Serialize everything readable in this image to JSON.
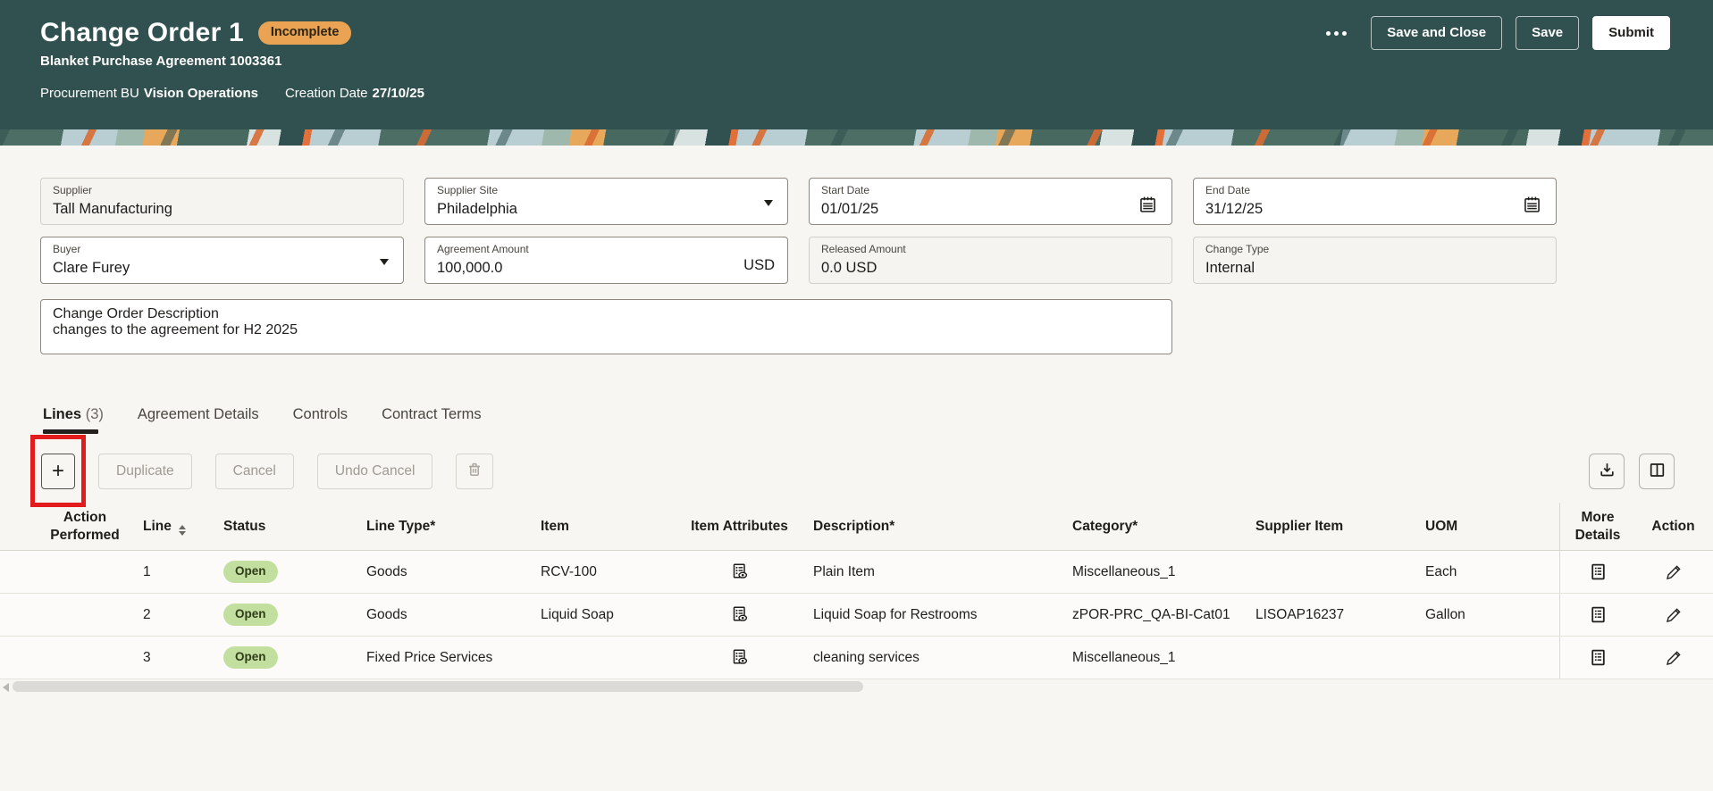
{
  "header": {
    "title": "Change Order 1",
    "status_badge": "Incomplete",
    "subtitle": "Blanket Purchase Agreement 1003361",
    "meta": [
      {
        "label": "Procurement BU",
        "value": "Vision Operations"
      },
      {
        "label": "Creation Date",
        "value": "27/10/25"
      }
    ],
    "actions": {
      "save_and_close": "Save and Close",
      "save": "Save",
      "submit": "Submit"
    }
  },
  "form": {
    "supplier": {
      "label": "Supplier",
      "value": "Tall Manufacturing"
    },
    "supplier_site": {
      "label": "Supplier Site",
      "value": "Philadelphia"
    },
    "start_date": {
      "label": "Start Date",
      "value": "01/01/25"
    },
    "end_date": {
      "label": "End Date",
      "value": "31/12/25"
    },
    "buyer": {
      "label": "Buyer",
      "value": "Clare Furey"
    },
    "agreement_amount": {
      "label": "Agreement Amount",
      "value": "100,000.0",
      "currency": "USD"
    },
    "released_amount": {
      "label": "Released Amount",
      "value": "0.0 USD"
    },
    "change_type": {
      "label": "Change Type",
      "value": "Internal"
    },
    "description": {
      "label": "Change Order Description",
      "value": "changes to the agreement for H2 2025"
    }
  },
  "tabs": [
    {
      "label": "Lines",
      "count": "(3)"
    },
    {
      "label": "Agreement Details"
    },
    {
      "label": "Controls"
    },
    {
      "label": "Contract Terms"
    }
  ],
  "toolbar": {
    "add": "+",
    "duplicate": "Duplicate",
    "cancel": "Cancel",
    "undo_cancel": "Undo Cancel"
  },
  "table": {
    "columns": [
      "Action Performed",
      "Line",
      "Status",
      "Line Type*",
      "Item",
      "Item Attributes",
      "Description*",
      "Category*",
      "Supplier Item",
      "UOM",
      "More Details",
      "Action"
    ],
    "rows": [
      {
        "action_performed": "",
        "line": "1",
        "status": "Open",
        "line_type": "Goods",
        "item": "RCV-100",
        "description": "Plain Item",
        "category": "Miscellaneous_1",
        "supplier_item": "",
        "uom": "Each"
      },
      {
        "action_performed": "",
        "line": "2",
        "status": "Open",
        "line_type": "Goods",
        "item": "Liquid Soap",
        "description": "Liquid Soap for Restrooms",
        "category": "zPOR-PRC_QA-BI-Cat01",
        "supplier_item": "LISOAP16237",
        "uom": "Gallon"
      },
      {
        "action_performed": "",
        "line": "3",
        "status": "Open",
        "line_type": "Fixed Price Services",
        "item": "",
        "description": "cleaning services",
        "category": "Miscellaneous_1",
        "supplier_item": "",
        "uom": ""
      }
    ]
  },
  "colors": {
    "header_bg": "#315150",
    "badge_bg": "#e9a352",
    "badge_text": "#2b2414",
    "status_pill_bg": "#c3df9f",
    "status_pill_text": "#2f3d1a",
    "annotation": "#e21c1c",
    "page_bg": "#f8f6f2"
  }
}
